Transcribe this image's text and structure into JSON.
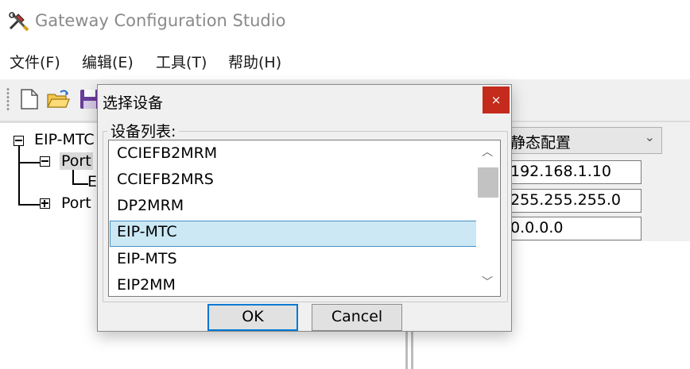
{
  "window": {
    "title": "Gateway Configuration Studio",
    "icon": "tools-icon"
  },
  "menubar": {
    "items": [
      "文件(F)",
      "编辑(E)",
      "工具(T)",
      "帮助(H)"
    ]
  },
  "toolbar": {
    "buttons": [
      "new-file-icon",
      "open-folder-icon",
      "save-icon"
    ]
  },
  "tree": {
    "root": "EIP-MTC",
    "port1": "Port",
    "child": "E",
    "port2": "Port"
  },
  "properties": {
    "mode": "静态配置",
    "ip": "192.168.1.10",
    "mask": "255.255.255.0",
    "gateway": "0.0.0.0"
  },
  "dialog": {
    "title": "选择设备",
    "close_symbol": "×",
    "group_label": "设备列表:",
    "devices": [
      "CCIEFB2MRM",
      "CCIEFB2MRS",
      "DP2MRM",
      "EIP-MTC",
      "EIP-MTS",
      "EIP2MM"
    ],
    "selected_index": 3,
    "ok_label": "OK",
    "cancel_label": "Cancel"
  },
  "colors": {
    "selection_bg": "#cce8f5",
    "selection_border": "#4a90c8",
    "close_button": "#c42b1c",
    "default_button_border": "#0078d4"
  }
}
